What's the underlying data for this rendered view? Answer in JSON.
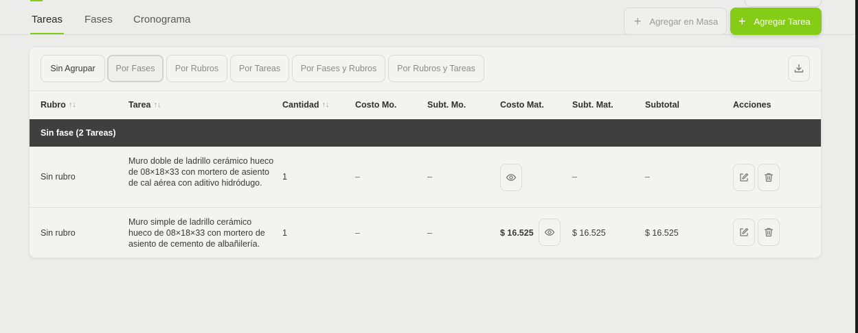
{
  "tabs": [
    {
      "label": "Tareas",
      "active": true
    },
    {
      "label": "Fases",
      "active": false
    },
    {
      "label": "Cronograma",
      "active": false
    }
  ],
  "actions": {
    "bulk_add_label": "Agregar en Masa",
    "add_task_label": "Agregar Tarea",
    "plus_glyph": "+"
  },
  "grouping": {
    "options": [
      "Sin Agrupar",
      "Por Fases",
      "Por Rubros",
      "Por Tareas",
      "Por Fases y Rubros",
      "Por Rubros y Tareas"
    ],
    "selected": "Por Fases"
  },
  "table": {
    "headers": [
      "Rubro",
      "Tarea",
      "Cantidad",
      "Costo Mo.",
      "Subt. Mo.",
      "Costo Mat.",
      "Subt. Mat.",
      "Subtotal",
      "Acciones"
    ],
    "sort_glyph": "↑↓",
    "group_label": "Sin fase (2 Tareas)",
    "rows": [
      {
        "rubro": "Sin rubro",
        "tarea": "Muro doble de ladrillo cerámico hueco de 08×18×33 con mortero de asiento de cal aérea con aditivo hidródugo.",
        "cantidad": "1",
        "costo_mo": "–",
        "subt_mo": "–",
        "costo_mat": "",
        "subt_mat": "–",
        "subtotal": "–"
      },
      {
        "rubro": "Sin rubro",
        "tarea": "Muro simple de ladrillo cerámico hueco de 08×18×33 con mortero de asiento de cemento de albañilería.",
        "cantidad": "1",
        "costo_mo": "–",
        "subt_mo": "–",
        "costo_mat": "$ 16.525",
        "subt_mat": "$ 16.525",
        "subtotal": "$ 16.525"
      }
    ]
  },
  "colors": {
    "accent": "#84cc16",
    "group_row": "#3f3f3f",
    "background": "#ececea",
    "card": "#f3f3f1"
  },
  "icons": [
    "plus-icon",
    "download-icon",
    "eye-icon",
    "edit-icon",
    "trash-icon",
    "sort-icon"
  ]
}
